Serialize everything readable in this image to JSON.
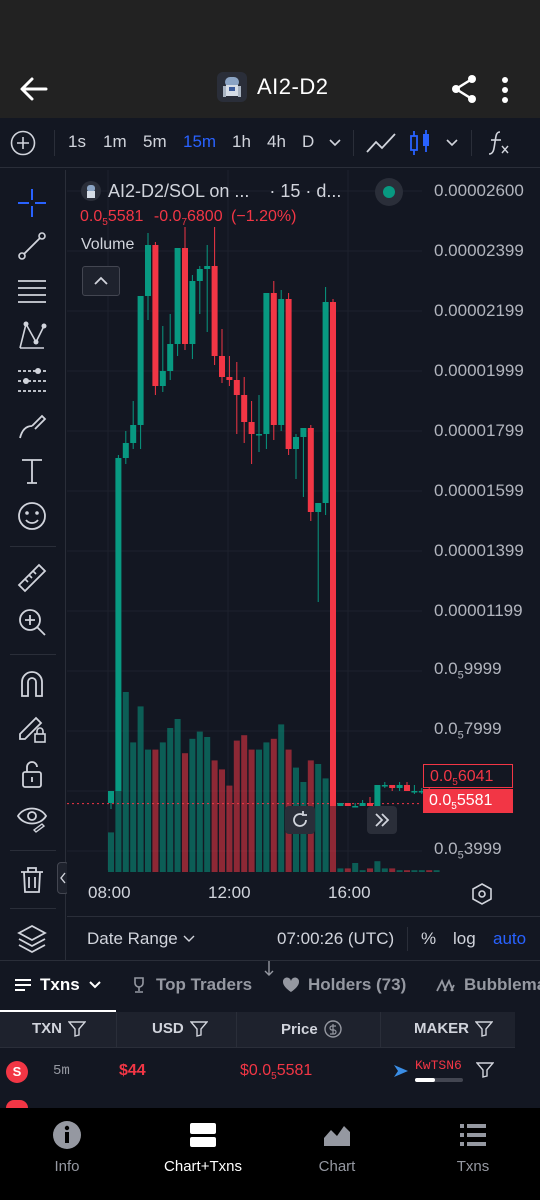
{
  "header": {
    "title": "AI2-D2"
  },
  "toolbar": {
    "timeframes": [
      {
        "label": "1s",
        "active": false
      },
      {
        "label": "1m",
        "active": false
      },
      {
        "label": "5m",
        "active": false
      },
      {
        "label": "15m",
        "active": true
      },
      {
        "label": "1h",
        "active": false
      },
      {
        "label": "4h",
        "active": false
      },
      {
        "label": "D",
        "active": false
      }
    ]
  },
  "chart": {
    "symbol": "AI2-D2/SOL on ...",
    "interval": "· 15 · d...",
    "last_price_prefix": "0.0",
    "last_price_sub": "5",
    "last_price_digits": "5581",
    "change_prefix": "-0.0",
    "change_sub": "7",
    "change_digits": "6800",
    "change_pct": "(−1.20%)",
    "volume_label": "Volume",
    "y_axis": [
      "0.00002600",
      "0.00002399",
      "0.00002199",
      "0.00001999",
      "0.00001799",
      "0.00001599",
      "0.00001399",
      "0.00001199"
    ],
    "y_axis_sub": [
      {
        "prefix": "0.0",
        "sub": "5",
        "digits": "9999"
      },
      {
        "prefix": "0.0",
        "sub": "5",
        "digits": "7999"
      },
      {
        "prefix": "0.0",
        "sub": "5",
        "digits": "3999"
      }
    ],
    "tag_high": {
      "prefix": "0.0",
      "sub": "5",
      "digits": "6041"
    },
    "tag_last": {
      "prefix": "0.0",
      "sub": "5",
      "digits": "5581"
    },
    "x_axis": [
      "08:00",
      "12:00",
      "16:00"
    ],
    "date_range": "Date Range",
    "time_utc": "07:00:26 (UTC)",
    "pct": "%",
    "log": "log",
    "auto": "auto"
  },
  "chart_data": {
    "type": "candlestick",
    "unit": "SOL",
    "ohlc_units": "1e-6 SOL",
    "candles": [
      {
        "o": 5.6,
        "h": 6.0,
        "l": 5.4,
        "c": 6.0
      },
      {
        "o": 6.0,
        "h": 17.2,
        "l": 6.0,
        "c": 17.1
      },
      {
        "o": 17.1,
        "h": 18.0,
        "l": 16.9,
        "c": 17.6
      },
      {
        "o": 17.6,
        "h": 19.0,
        "l": 17.4,
        "c": 18.2
      },
      {
        "o": 18.2,
        "h": 22.5,
        "l": 17.4,
        "c": 22.5
      },
      {
        "o": 22.5,
        "h": 24.6,
        "l": 21.7,
        "c": 24.2
      },
      {
        "o": 24.2,
        "h": 24.3,
        "l": 19.2,
        "c": 19.5
      },
      {
        "o": 19.5,
        "h": 21.5,
        "l": 19.3,
        "c": 20.0
      },
      {
        "o": 20.0,
        "h": 21.9,
        "l": 19.7,
        "c": 20.9
      },
      {
        "o": 20.9,
        "h": 24.1,
        "l": 20.5,
        "c": 24.1
      },
      {
        "o": 24.1,
        "h": 24.8,
        "l": 20.7,
        "c": 20.9
      },
      {
        "o": 20.9,
        "h": 23.2,
        "l": 20.4,
        "c": 23.0
      },
      {
        "o": 23.0,
        "h": 23.5,
        "l": 21.9,
        "c": 23.4
      },
      {
        "o": 23.4,
        "h": 24.2,
        "l": 21.3,
        "c": 23.5
      },
      {
        "o": 23.5,
        "h": 24.8,
        "l": 20.2,
        "c": 20.5
      },
      {
        "o": 20.5,
        "h": 21.4,
        "l": 19.6,
        "c": 19.8
      },
      {
        "o": 19.8,
        "h": 20.5,
        "l": 19.5,
        "c": 19.7
      },
      {
        "o": 19.7,
        "h": 20.3,
        "l": 17.9,
        "c": 19.2
      },
      {
        "o": 19.2,
        "h": 19.8,
        "l": 17.6,
        "c": 18.3
      },
      {
        "o": 18.3,
        "h": 19.0,
        "l": 16.9,
        "c": 17.9
      },
      {
        "o": 17.9,
        "h": 19.2,
        "l": 17.3,
        "c": 17.9
      },
      {
        "o": 17.9,
        "h": 22.6,
        "l": 17.4,
        "c": 22.6
      },
      {
        "o": 22.6,
        "h": 23.0,
        "l": 17.7,
        "c": 18.2
      },
      {
        "o": 18.2,
        "h": 22.7,
        "l": 18.0,
        "c": 22.4
      },
      {
        "o": 22.4,
        "h": 22.6,
        "l": 17.2,
        "c": 17.4
      },
      {
        "o": 17.4,
        "h": 17.9,
        "l": 16.4,
        "c": 17.8
      },
      {
        "o": 17.8,
        "h": 18.0,
        "l": 15.8,
        "c": 18.1
      },
      {
        "o": 18.1,
        "h": 18.2,
        "l": 15.0,
        "c": 15.3
      },
      {
        "o": 15.3,
        "h": 15.6,
        "l": 12.3,
        "c": 15.6
      },
      {
        "o": 15.6,
        "h": 22.8,
        "l": 15.2,
        "c": 22.3
      },
      {
        "o": 22.3,
        "h": 22.4,
        "l": 5.5,
        "c": 5.5
      },
      {
        "o": 5.5,
        "h": 5.6,
        "l": 5.5,
        "c": 5.6
      },
      {
        "o": 5.6,
        "h": 5.6,
        "l": 5.5,
        "c": 5.5
      },
      {
        "o": 5.5,
        "h": 5.6,
        "l": 5.5,
        "c": 5.5
      },
      {
        "o": 5.5,
        "h": 5.7,
        "l": 5.5,
        "c": 5.6
      },
      {
        "o": 5.6,
        "h": 5.8,
        "l": 5.5,
        "c": 5.5
      },
      {
        "o": 5.5,
        "h": 6.2,
        "l": 5.5,
        "c": 6.2
      },
      {
        "o": 6.2,
        "h": 6.3,
        "l": 6.1,
        "c": 6.2
      },
      {
        "o": 6.2,
        "h": 6.2,
        "l": 6.0,
        "c": 6.1
      },
      {
        "o": 6.1,
        "h": 6.3,
        "l": 6.0,
        "c": 6.2
      },
      {
        "o": 6.2,
        "h": 6.3,
        "l": 6.0,
        "c": 6.0
      },
      {
        "o": 6.0,
        "h": 6.2,
        "l": 5.9,
        "c": 6.0
      },
      {
        "o": 6.0,
        "h": 6.1,
        "l": 5.9,
        "c": 6.0
      },
      {
        "o": 6.0,
        "h": 6.1,
        "l": 5.9,
        "c": 5.9
      },
      {
        "o": 5.9,
        "h": 6.0,
        "l": 5.8,
        "c": 5.9
      }
    ],
    "volume": [
      0.22,
      0.97,
      1.0,
      0.72,
      0.92,
      0.68,
      0.68,
      0.72,
      0.8,
      0.85,
      0.66,
      0.74,
      0.78,
      0.75,
      0.62,
      0.57,
      0.48,
      0.73,
      0.76,
      0.68,
      0.68,
      0.72,
      0.74,
      0.82,
      0.68,
      0.58,
      0.5,
      0.62,
      0.6,
      0.52,
      0.86,
      0.02,
      0.02,
      0.05,
      0.01,
      0.02,
      0.06,
      0.02,
      0.02,
      0.01,
      0.01,
      0.01,
      0.01,
      0.01,
      0.01
    ],
    "ylim": [
      3e-06,
      2.6e-05
    ],
    "x_ticks": [
      "08:00",
      "12:00",
      "16:00"
    ]
  },
  "tabs": [
    {
      "label": "Txns",
      "active": true
    },
    {
      "label": "Top Traders",
      "active": false
    },
    {
      "label": "Holders (73)",
      "active": false
    },
    {
      "label": "Bubblemaps",
      "active": false
    }
  ],
  "table": {
    "headers": [
      "TXN",
      "USD",
      "Price",
      "MAKER"
    ],
    "rows": [
      {
        "badge": "S",
        "age": "5m",
        "usd": "$44",
        "price_prefix": "$0.0",
        "price_sub": "5",
        "price_digits": "5581",
        "maker": "KwTSN6"
      }
    ]
  },
  "nav": [
    {
      "label": "Info",
      "active": false
    },
    {
      "label": "Chart+Txns",
      "active": true
    },
    {
      "label": "Chart",
      "active": false
    },
    {
      "label": "Txns",
      "active": false
    }
  ],
  "colors": {
    "up": "#089981",
    "down": "#f23645",
    "accent": "#2962ff"
  }
}
